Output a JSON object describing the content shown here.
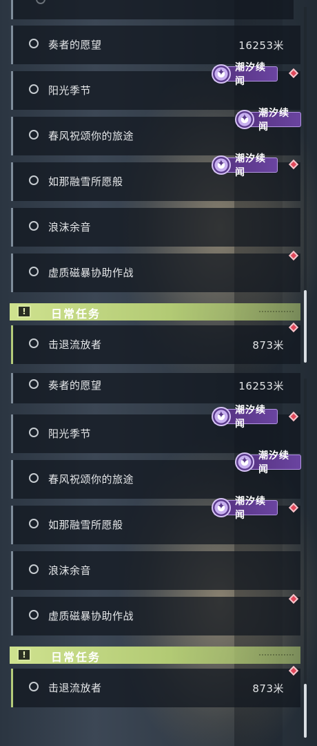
{
  "section": {
    "title": "日常任务"
  },
  "tag": {
    "label": "潮汐续闻"
  },
  "quests": [
    {
      "name": "奏者的愿望",
      "distance": "16253米"
    },
    {
      "name": "阳光季节",
      "distance": ""
    },
    {
      "name": "春风祝颂你的旅途",
      "distance": ""
    },
    {
      "name": "如那融雪所愿般",
      "distance": ""
    },
    {
      "name": "浪沫余音",
      "distance": ""
    },
    {
      "name": "虚质磁暴协助作战",
      "distance": ""
    }
  ],
  "daily": [
    {
      "name": "击退流放者",
      "distance": "873米"
    }
  ],
  "colors": {
    "accent_green": "#b4cc7a",
    "tag_purple": "#6a44a0",
    "marker_red": "#e0485b"
  }
}
